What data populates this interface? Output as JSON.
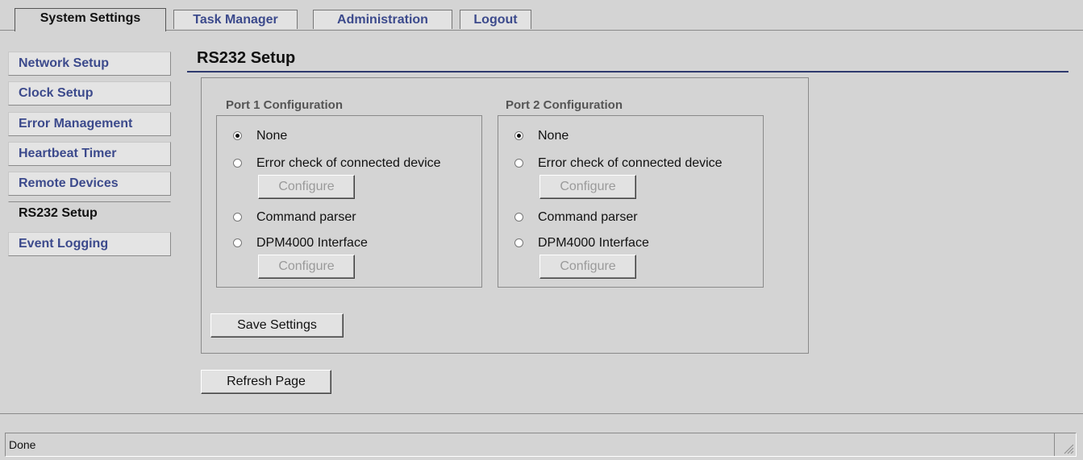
{
  "tabs": [
    {
      "label": "System Settings",
      "active": true
    },
    {
      "label": "Task Manager",
      "active": false
    },
    {
      "label": "Administration",
      "active": false
    },
    {
      "label": "Logout",
      "active": false
    }
  ],
  "sidebar": {
    "items": [
      {
        "label": "Network Setup",
        "active": false
      },
      {
        "label": "Clock Setup",
        "active": false
      },
      {
        "label": "Error Management",
        "active": false
      },
      {
        "label": "Heartbeat Timer",
        "active": false
      },
      {
        "label": "Remote Devices",
        "active": false
      },
      {
        "label": "RS232 Setup",
        "active": true
      },
      {
        "label": "Event Logging",
        "active": false
      }
    ]
  },
  "main": {
    "title": "RS232 Setup",
    "ports": [
      {
        "legend": "Port 1 Configuration",
        "options": {
          "none": "None",
          "error_check": "Error check of connected device",
          "command_parser": "Command parser",
          "dpm4000": "DPM4000 Interface"
        },
        "selected": "None",
        "configure_label": "Configure"
      },
      {
        "legend": "Port 2 Configuration",
        "options": {
          "none": "None",
          "error_check": "Error check of connected device",
          "command_parser": "Command parser",
          "dpm4000": "DPM4000 Interface"
        },
        "selected": "None",
        "configure_label": "Configure"
      }
    ],
    "save_label": "Save Settings",
    "refresh_label": "Refresh Page"
  },
  "status": {
    "text": "Done"
  },
  "colors": {
    "background": "#d4d4d4",
    "link_text": "#3c4a8c",
    "title_rule": "#2e3a6e",
    "disabled_text": "#9a9a9a"
  }
}
